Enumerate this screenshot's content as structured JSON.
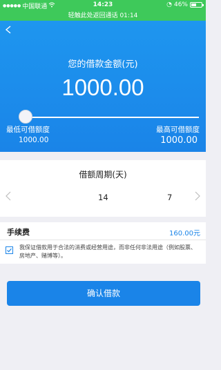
{
  "status_bar": {
    "carrier": "中国联通",
    "time": "14:23",
    "battery": "46%",
    "banner": "轻触此处返回通话 01:14"
  },
  "hero": {
    "label": "您的借款金额(元)",
    "amount": "1000.00",
    "slider_value_fraction": 0.0,
    "min_label": "最低可借额度",
    "min_value": "1000.00",
    "max_label": "最高可借额度",
    "max_value": "1000.00"
  },
  "period": {
    "title": "借额周期(天)",
    "options": [
      "14",
      "7"
    ]
  },
  "fee": {
    "label": "手续费",
    "value": "160.00元"
  },
  "agreement": {
    "checked": true,
    "text": "我保证借款用于合法的消费或经营用途，而非任何非法用途（例如股票、房地产、赌博等）。"
  },
  "confirm_label": "确认借款",
  "colors": {
    "primary": "#1a84e8",
    "status_bar": "#3ec95a"
  }
}
